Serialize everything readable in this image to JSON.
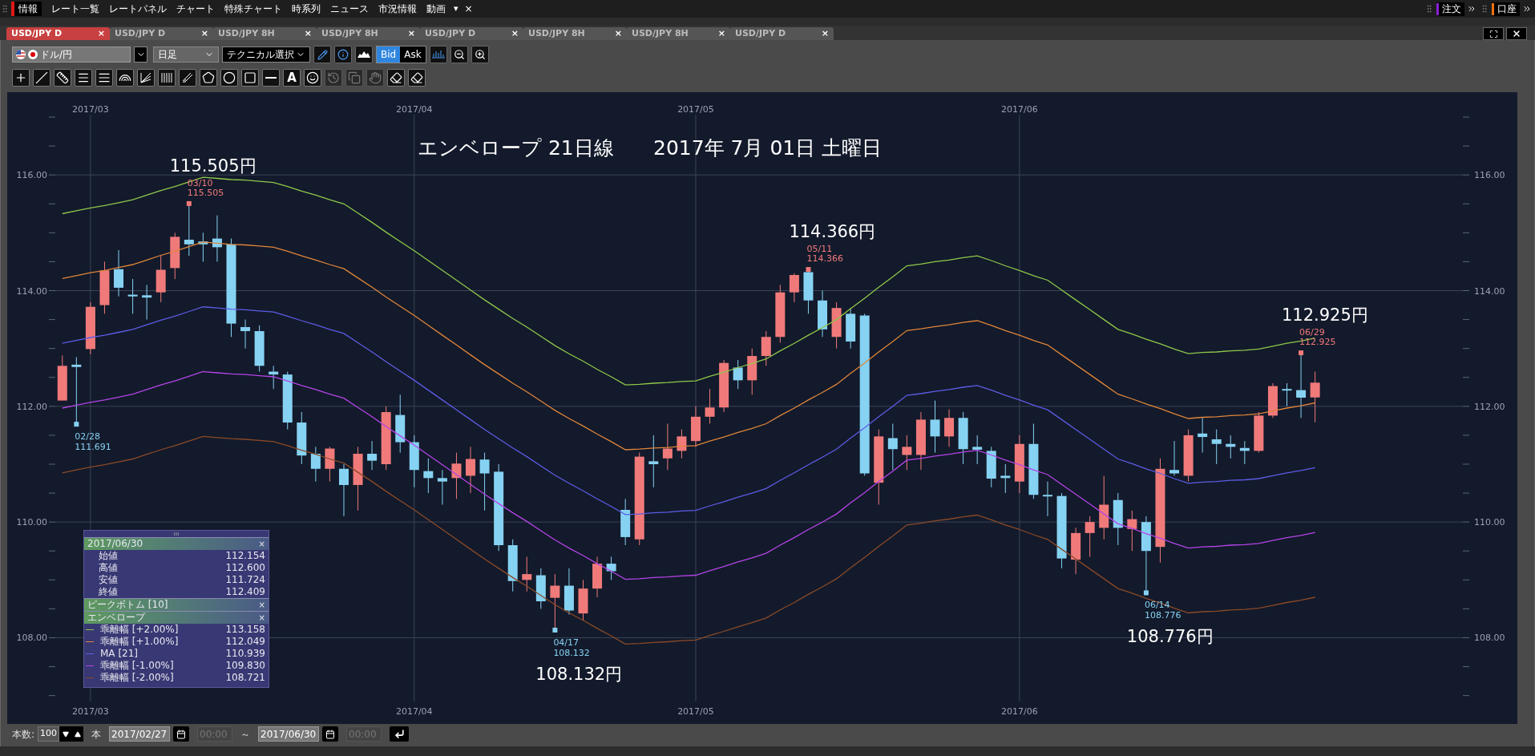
{
  "menu_bar": {
    "items": [
      {
        "label": "情報",
        "selected": true
      },
      {
        "label": "レート一覧",
        "selected": false
      },
      {
        "label": "レートパネル",
        "selected": false
      },
      {
        "label": "チャート",
        "selected": false
      },
      {
        "label": "特殊チャート",
        "selected": false
      },
      {
        "label": "時系列",
        "selected": false
      },
      {
        "label": "ニュース",
        "selected": false
      },
      {
        "label": "市況情報",
        "selected": false
      },
      {
        "label": "動画",
        "selected": false
      }
    ],
    "overflow": "▾",
    "close": "×",
    "right_items": [
      {
        "label": "注文",
        "color": "#8a1fd6"
      },
      {
        "label": "口座",
        "color": "#f07010"
      }
    ]
  },
  "tabs": [
    {
      "label": "USD/JPY D",
      "selected": true,
      "close": "×"
    },
    {
      "label": "USD/JPY D",
      "selected": false,
      "close": "×"
    },
    {
      "label": "USD/JPY 8H",
      "selected": false,
      "close": "×"
    },
    {
      "label": "USD/JPY 8H",
      "selected": false,
      "close": "×"
    },
    {
      "label": "USD/JPY D",
      "selected": false,
      "close": "×"
    },
    {
      "label": "USD/JPY 8H",
      "selected": false,
      "close": "×"
    },
    {
      "label": "USD/JPY 8H",
      "selected": false,
      "close": "×"
    },
    {
      "label": "USD/JPY D",
      "selected": false,
      "close": "×"
    }
  ],
  "toolbar": {
    "pair": "ドル/円",
    "timeframe": "日足",
    "technical": "テクニカル選択",
    "price_side": [
      {
        "label": "Bid",
        "selected": true
      },
      {
        "label": "Ask",
        "selected": false
      }
    ]
  },
  "drawing_tools": [
    {
      "kind": "icon",
      "disabled": false
    },
    {
      "kind": "icon",
      "disabled": false
    },
    {
      "kind": "icon",
      "disabled": false
    },
    {
      "kind": "icon",
      "disabled": false
    },
    {
      "kind": "icon",
      "disabled": false
    },
    {
      "kind": "icon",
      "disabled": false
    },
    {
      "kind": "icon",
      "disabled": false
    },
    {
      "kind": "icon",
      "disabled": false
    },
    {
      "kind": "icon",
      "disabled": false
    },
    {
      "kind": "icon",
      "disabled": false
    },
    {
      "kind": "icon",
      "disabled": false
    },
    {
      "kind": "icon",
      "disabled": false
    },
    {
      "kind": "icon",
      "disabled": false
    },
    {
      "kind": "text",
      "label": "A",
      "disabled": false
    },
    {
      "kind": "icon",
      "disabled": false
    },
    {
      "kind": "icon",
      "disabled": true
    },
    {
      "kind": "icon",
      "disabled": true
    },
    {
      "kind": "icon",
      "disabled": true
    },
    {
      "kind": "icon",
      "disabled": false
    },
    {
      "kind": "icon",
      "disabled": false
    }
  ],
  "chart": {
    "title": "エンベロープ 21日線",
    "date": "2017年 7月 01日 土曜日",
    "chart_data": {
      "type": "candlestick",
      "grid": true,
      "legend": "lower left",
      "ylim": [
        106.51,
        117.43
      ],
      "categories": [
        null,
        null,
        "2017/03",
        null,
        null,
        null,
        null,
        null,
        null,
        null,
        null,
        null,
        null,
        null,
        null,
        null,
        null,
        null,
        null,
        null,
        null,
        null,
        null,
        null,
        null,
        "2017/04",
        null,
        null,
        null,
        null,
        null,
        null,
        null,
        null,
        null,
        null,
        null,
        null,
        null,
        null,
        null,
        null,
        null,
        null,
        null,
        "2017/05",
        null,
        null,
        null,
        null,
        null,
        null,
        null,
        null,
        null,
        null,
        null,
        null,
        null,
        null,
        null,
        null,
        null,
        null,
        null,
        null,
        null,
        null,
        "2017/06",
        null,
        null,
        null,
        null,
        null,
        null,
        null,
        null,
        null,
        null,
        null,
        null,
        null,
        null,
        null,
        null,
        null,
        null,
        null,
        null,
        null,
        null,
        null,
        null,
        null,
        null,
        null,
        null,
        null,
        null,
        null
      ],
      "yticks": [
        {
          "value": 108,
          "label": "108.00"
        },
        {
          "value": 110,
          "label": "110.00"
        },
        {
          "value": 112,
          "label": "112.00"
        },
        {
          "value": 114,
          "label": "114.00"
        },
        {
          "value": 116,
          "label": "116.00"
        }
      ],
      "series": [
        {
          "name": "乖離幅 [+2.00%]",
          "type": "line",
          "color": "#8fc84a",
          "values": [
            115.33,
            115.38,
            115.43,
            115.47,
            115.52,
            115.57,
            115.65,
            115.73,
            115.8,
            115.88,
            115.96,
            115.94,
            115.92,
            115.91,
            115.89,
            115.87,
            115.8,
            115.72,
            115.65,
            115.57,
            115.5,
            115.34,
            115.18,
            115.01,
            114.85,
            114.69,
            114.52,
            114.35,
            114.18,
            114.01,
            113.84,
            113.68,
            113.52,
            113.37,
            113.21,
            113.05,
            112.91,
            112.78,
            112.64,
            112.51,
            112.37,
            112.38,
            112.4,
            112.41,
            112.43,
            112.44,
            112.52,
            112.59,
            112.67,
            112.74,
            112.82,
            112.96,
            113.09,
            113.23,
            113.36,
            113.5,
            113.69,
            113.87,
            114.06,
            114.24,
            114.43,
            114.46,
            114.5,
            114.53,
            114.57,
            114.6,
            114.52,
            114.43,
            114.35,
            114.26,
            114.18,
            114.01,
            113.84,
            113.67,
            113.5,
            113.33,
            113.25,
            113.16,
            113.08,
            112.99,
            112.91,
            112.93,
            112.94,
            112.96,
            112.97,
            112.99,
            113.04,
            113.09,
            113.13,
            113.18,
            null,
            null,
            null,
            null,
            null,
            null,
            null,
            null,
            null,
            null
          ]
        },
        {
          "name": "乖離幅 [+1.00%]",
          "type": "line",
          "color": "#e0853a",
          "values": [
            114.21,
            114.26,
            114.31,
            114.35,
            114.4,
            114.45,
            114.53,
            114.61,
            114.68,
            114.76,
            114.84,
            114.82,
            114.8,
            114.79,
            114.77,
            114.75,
            114.68,
            114.6,
            114.53,
            114.45,
            114.38,
            114.22,
            114.06,
            113.89,
            113.73,
            113.57,
            113.4,
            113.23,
            113.06,
            112.89,
            112.72,
            112.56,
            112.4,
            112.25,
            112.09,
            111.93,
            111.79,
            111.66,
            111.52,
            111.39,
            111.25,
            111.26,
            111.28,
            111.29,
            111.31,
            111.32,
            111.4,
            111.47,
            111.55,
            111.62,
            111.7,
            111.84,
            111.97,
            112.11,
            112.24,
            112.38,
            112.57,
            112.75,
            112.94,
            113.12,
            113.31,
            113.34,
            113.38,
            113.41,
            113.45,
            113.48,
            113.4,
            113.31,
            113.23,
            113.14,
            113.06,
            112.89,
            112.72,
            112.55,
            112.38,
            112.21,
            112.13,
            112.04,
            111.96,
            111.87,
            111.79,
            111.81,
            111.82,
            111.84,
            111.85,
            111.87,
            111.92,
            111.97,
            112.01,
            112.06,
            null,
            null,
            null,
            null,
            null,
            null,
            null,
            null,
            null,
            null
          ]
        },
        {
          "name": "MA [21]",
          "type": "line",
          "color": "#5c5ce6",
          "values": [
            113.09,
            113.14,
            113.19,
            113.23,
            113.28,
            113.33,
            113.41,
            113.49,
            113.56,
            113.64,
            113.72,
            113.7,
            113.68,
            113.67,
            113.65,
            113.63,
            113.56,
            113.48,
            113.41,
            113.33,
            113.26,
            113.1,
            112.94,
            112.77,
            112.61,
            112.45,
            112.28,
            112.11,
            111.94,
            111.77,
            111.6,
            111.44,
            111.28,
            111.13,
            110.97,
            110.81,
            110.67,
            110.54,
            110.4,
            110.27,
            110.13,
            110.14,
            110.16,
            110.17,
            110.19,
            110.2,
            110.28,
            110.35,
            110.43,
            110.5,
            110.58,
            110.72,
            110.85,
            110.99,
            111.12,
            111.26,
            111.45,
            111.63,
            111.82,
            112.0,
            112.19,
            112.22,
            112.26,
            112.29,
            112.33,
            112.36,
            112.28,
            112.19,
            112.11,
            112.02,
            111.94,
            111.77,
            111.6,
            111.43,
            111.26,
            111.09,
            111.01,
            110.92,
            110.84,
            110.75,
            110.67,
            110.69,
            110.7,
            110.72,
            110.73,
            110.75,
            110.8,
            110.85,
            110.89,
            110.94,
            null,
            null,
            null,
            null,
            null,
            null,
            null,
            null,
            null,
            null
          ]
        },
        {
          "name": "乖離幅 [-1.00%]",
          "type": "line",
          "color": "#b444e8",
          "values": [
            111.97,
            112.02,
            112.07,
            112.11,
            112.16,
            112.21,
            112.29,
            112.37,
            112.44,
            112.52,
            112.6,
            112.58,
            112.56,
            112.55,
            112.53,
            112.51,
            112.44,
            112.36,
            112.29,
            112.21,
            112.14,
            111.98,
            111.82,
            111.65,
            111.49,
            111.33,
            111.16,
            110.99,
            110.82,
            110.65,
            110.48,
            110.32,
            110.16,
            110.01,
            109.85,
            109.69,
            109.55,
            109.42,
            109.28,
            109.15,
            109.01,
            109.02,
            109.04,
            109.05,
            109.07,
            109.08,
            109.16,
            109.23,
            109.31,
            109.38,
            109.46,
            109.6,
            109.73,
            109.87,
            110.0,
            110.14,
            110.33,
            110.51,
            110.7,
            110.88,
            111.07,
            111.1,
            111.14,
            111.17,
            111.21,
            111.24,
            111.16,
            111.07,
            110.99,
            110.9,
            110.82,
            110.65,
            110.48,
            110.31,
            110.14,
            109.97,
            109.89,
            109.8,
            109.72,
            109.63,
            109.55,
            109.57,
            109.58,
            109.6,
            109.61,
            109.63,
            109.68,
            109.73,
            109.77,
            109.82,
            null,
            null,
            null,
            null,
            null,
            null,
            null,
            null,
            null,
            null
          ]
        },
        {
          "name": "乖離幅 [-2.00%]",
          "type": "line",
          "color": "#8c4a28",
          "values": [
            110.85,
            110.9,
            110.95,
            110.99,
            111.04,
            111.09,
            111.17,
            111.25,
            111.32,
            111.4,
            111.48,
            111.46,
            111.44,
            111.43,
            111.41,
            111.39,
            111.32,
            111.24,
            111.17,
            111.09,
            111.02,
            110.86,
            110.7,
            110.53,
            110.37,
            110.21,
            110.04,
            109.87,
            109.7,
            109.53,
            109.36,
            109.2,
            109.04,
            108.89,
            108.73,
            108.57,
            108.43,
            108.3,
            108.16,
            108.03,
            107.89,
            107.9,
            107.92,
            107.93,
            107.95,
            107.96,
            108.04,
            108.11,
            108.19,
            108.26,
            108.34,
            108.48,
            108.61,
            108.75,
            108.88,
            109.02,
            109.21,
            109.39,
            109.58,
            109.76,
            109.95,
            109.98,
            110.02,
            110.05,
            110.09,
            110.12,
            110.04,
            109.95,
            109.87,
            109.78,
            109.7,
            109.53,
            109.36,
            109.19,
            109.02,
            108.85,
            108.77,
            108.68,
            108.6,
            108.51,
            108.43,
            108.45,
            108.46,
            108.48,
            108.49,
            108.51,
            108.56,
            108.61,
            108.65,
            108.7,
            null,
            null,
            null,
            null,
            null,
            null,
            null,
            null,
            null,
            null
          ]
        }
      ],
      "ohlc": [
        [
          112.1,
          112.88,
          112.1,
          112.7
        ],
        [
          112.72,
          112.85,
          111.691,
          112.68
        ],
        [
          112.99,
          113.8,
          112.9,
          113.72
        ],
        [
          113.75,
          114.5,
          113.6,
          114.35
        ],
        [
          114.37,
          114.7,
          113.9,
          114.05
        ],
        [
          113.93,
          114.2,
          113.6,
          113.9
        ],
        [
          113.92,
          114.1,
          113.5,
          113.88
        ],
        [
          113.97,
          114.6,
          113.8,
          114.36
        ],
        [
          114.39,
          115.0,
          114.2,
          114.93
        ],
        [
          114.88,
          115.505,
          114.6,
          114.8
        ],
        [
          114.85,
          115.0,
          114.5,
          114.8
        ],
        [
          114.9,
          115.3,
          114.5,
          114.75
        ],
        [
          114.8,
          114.9,
          113.2,
          113.43
        ],
        [
          113.37,
          113.5,
          113.0,
          113.3
        ],
        [
          113.3,
          113.4,
          112.6,
          112.7
        ],
        [
          112.6,
          112.7,
          112.3,
          112.55
        ],
        [
          112.55,
          112.6,
          111.6,
          111.72
        ],
        [
          111.72,
          111.9,
          111.0,
          111.15
        ],
        [
          111.18,
          111.3,
          110.7,
          110.92
        ],
        [
          110.92,
          111.3,
          110.7,
          111.27
        ],
        [
          110.92,
          111.0,
          110.1,
          110.64
        ],
        [
          110.64,
          111.3,
          110.2,
          111.18
        ],
        [
          111.18,
          111.4,
          110.9,
          111.06
        ],
        [
          111.0,
          112.0,
          110.9,
          111.9
        ],
        [
          111.85,
          112.2,
          111.2,
          111.38
        ],
        [
          111.38,
          111.5,
          110.6,
          110.9
        ],
        [
          110.88,
          111.1,
          110.5,
          110.76
        ],
        [
          110.76,
          110.9,
          110.3,
          110.7
        ],
        [
          110.76,
          111.2,
          110.4,
          111.01
        ],
        [
          110.8,
          111.3,
          110.5,
          111.09
        ],
        [
          111.08,
          111.2,
          110.2,
          110.84
        ],
        [
          110.87,
          111.0,
          109.5,
          109.6
        ],
        [
          109.6,
          109.7,
          108.8,
          108.98
        ],
        [
          109.0,
          109.4,
          108.8,
          109.1
        ],
        [
          109.08,
          109.2,
          108.5,
          108.63
        ],
        [
          108.69,
          109.1,
          108.132,
          108.9
        ],
        [
          108.9,
          109.2,
          108.4,
          108.47
        ],
        [
          108.42,
          109.0,
          108.3,
          108.85
        ],
        [
          108.85,
          109.4,
          108.7,
          109.28
        ],
        [
          109.28,
          109.4,
          109.0,
          109.15
        ],
        [
          110.21,
          110.4,
          109.6,
          109.74
        ],
        [
          109.7,
          111.2,
          109.6,
          111.13
        ],
        [
          111.05,
          111.5,
          110.6,
          111.0
        ],
        [
          111.1,
          111.7,
          110.9,
          111.27
        ],
        [
          111.23,
          111.6,
          111.1,
          111.48
        ],
        [
          111.4,
          112.0,
          111.3,
          111.82
        ],
        [
          111.82,
          112.3,
          111.7,
          111.98
        ],
        [
          111.98,
          112.8,
          111.9,
          112.75
        ],
        [
          112.67,
          112.8,
          112.3,
          112.45
        ],
        [
          112.45,
          113.0,
          112.2,
          112.87
        ],
        [
          112.87,
          113.3,
          112.7,
          113.2
        ],
        [
          113.2,
          114.1,
          113.1,
          113.97
        ],
        [
          113.97,
          114.3,
          113.8,
          114.27
        ],
        [
          114.32,
          114.366,
          113.6,
          113.83
        ],
        [
          113.83,
          114.0,
          113.2,
          113.33
        ],
        [
          113.2,
          113.8,
          113.0,
          113.7
        ],
        [
          113.6,
          113.7,
          113.0,
          113.12
        ],
        [
          113.57,
          113.6,
          110.8,
          110.84
        ],
        [
          110.68,
          111.6,
          110.3,
          111.48
        ],
        [
          111.45,
          111.7,
          110.9,
          111.26
        ],
        [
          111.16,
          111.5,
          110.9,
          111.3
        ],
        [
          111.16,
          111.9,
          110.9,
          111.77
        ],
        [
          111.77,
          112.1,
          111.2,
          111.48
        ],
        [
          111.48,
          111.95,
          111.3,
          111.8
        ],
        [
          111.8,
          111.9,
          111.0,
          111.26
        ],
        [
          111.3,
          111.5,
          111.0,
          111.25
        ],
        [
          111.23,
          111.3,
          110.6,
          110.75
        ],
        [
          110.8,
          111.0,
          110.5,
          110.76
        ],
        [
          110.7,
          111.5,
          110.5,
          111.35
        ],
        [
          111.35,
          111.7,
          110.4,
          110.47
        ],
        [
          110.47,
          110.7,
          110.1,
          110.45
        ],
        [
          110.45,
          110.5,
          109.2,
          109.37
        ],
        [
          109.35,
          109.9,
          109.1,
          109.81
        ],
        [
          109.81,
          110.1,
          109.4,
          110.0
        ],
        [
          109.9,
          110.8,
          109.7,
          110.3
        ],
        [
          110.38,
          110.5,
          109.6,
          109.9
        ],
        [
          109.88,
          110.2,
          109.5,
          110.05
        ],
        [
          110.0,
          110.1,
          108.776,
          109.5
        ],
        [
          109.57,
          111.1,
          109.3,
          110.92
        ],
        [
          110.9,
          111.4,
          110.8,
          110.84
        ],
        [
          110.8,
          111.6,
          110.7,
          111.5
        ],
        [
          111.53,
          111.8,
          111.2,
          111.47
        ],
        [
          111.43,
          111.6,
          111.0,
          111.35
        ],
        [
          111.35,
          111.5,
          111.1,
          111.3
        ],
        [
          111.28,
          111.4,
          111.0,
          111.23
        ],
        [
          111.23,
          111.9,
          111.2,
          111.84
        ],
        [
          111.84,
          112.4,
          111.8,
          112.35
        ],
        [
          112.3,
          112.4,
          112.0,
          112.28
        ],
        [
          112.28,
          112.925,
          111.8,
          112.15
        ],
        [
          112.154,
          112.6,
          111.724,
          112.409
        ],
        null,
        null,
        null,
        null,
        null,
        null,
        null,
        null,
        null,
        null
      ],
      "annotations": [
        "03/10",
        "115.505",
        "115.505円",
        "05/11",
        "114.366",
        "114.366円",
        "06/29",
        "112.925",
        "112.925円",
        "02/28",
        "111.691",
        "04/17",
        "108.132",
        "108.132円",
        "06/14",
        "108.776",
        "108.776円"
      ]
    },
    "info_panel": {
      "date": "2017/06/30",
      "close": "×",
      "ohlc": [
        {
          "label": "始値",
          "value": "112.154"
        },
        {
          "label": "高値",
          "value": "112.600"
        },
        {
          "label": "安値",
          "value": "111.724"
        },
        {
          "label": "終値",
          "value": "112.409"
        }
      ],
      "sections": [
        {
          "label": "ピークボトム [10]",
          "close": "×"
        },
        {
          "label": "エンベロープ",
          "close": "×"
        }
      ],
      "envelope": [
        {
          "value": "113.158"
        },
        {
          "value": "112.049"
        },
        {
          "value": "110.939"
        },
        {
          "value": "109.830"
        },
        {
          "value": "108.721"
        }
      ]
    }
  },
  "bottom_bar": {
    "count_label": "本数:",
    "count": "100",
    "unit": "本",
    "start_date": "2017/02/27",
    "start_time": {
      "placeholder": "00:00",
      "disabled": true
    },
    "separator": "～",
    "end_date": "2017/06/30",
    "end_time": {
      "placeholder": "00:00",
      "disabled": true
    }
  }
}
